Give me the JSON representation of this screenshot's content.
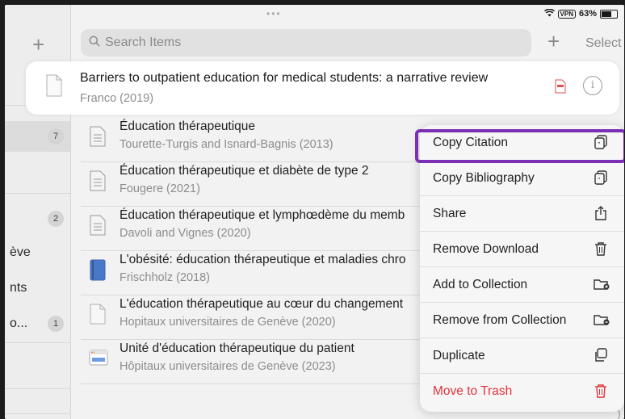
{
  "status_bar": {
    "dots": "•••",
    "vpn": "VPN",
    "battery": "63%"
  },
  "sidebar": {
    "items": [
      {
        "label": "",
        "count": "7"
      },
      {
        "label": "",
        "count": "2"
      },
      {
        "label": "ève",
        "count": ""
      },
      {
        "label": "nts",
        "count": ""
      },
      {
        "label": "o...",
        "count": "1"
      }
    ]
  },
  "toolbar": {
    "search_placeholder": "Search Items",
    "select_label": "Select"
  },
  "selected_item": {
    "title": "Barriers to outpatient education for medical students: a narrative review",
    "subtitle": "Franco (2019)"
  },
  "items": [
    {
      "title": "Éducation thérapeutique",
      "subtitle": "Tourette-Turgis and Isnard-Bagnis (2013)",
      "icon": "document-icon"
    },
    {
      "title": "Éducation thérapeutique et diabète de type 2",
      "subtitle": "Fougere (2021)",
      "icon": "document-icon"
    },
    {
      "title": "Éducation thérapeutique et lymphœdème du memb",
      "subtitle": "Davoli and Vignes (2020)",
      "icon": "document-icon"
    },
    {
      "title": "L'obésité: éducation thérapeutique et maladies chro",
      "subtitle": "Frischholz (2018)",
      "icon": "book-icon"
    },
    {
      "title": "L'éducation thérapeutique au cœur du changement",
      "subtitle": "Hopitaux universitaires de Genève  (2020)",
      "icon": "blank-document-icon"
    },
    {
      "title": "Unité d'éducation thérapeutique du patient",
      "subtitle": "Hôpitaux universitaires de Genève (2023)",
      "icon": "webpage-icon"
    }
  ],
  "context_menu": {
    "items": [
      {
        "label": "Copy Citation",
        "icon": "copy-citation-icon"
      },
      {
        "label": "Copy Bibliography",
        "icon": "copy-bibliography-icon"
      },
      {
        "label": "Share",
        "icon": "share-icon"
      },
      {
        "label": "Remove Download",
        "icon": "trash-icon"
      },
      {
        "label": "Add to Collection",
        "icon": "folder-add-icon"
      },
      {
        "label": "Remove from Collection",
        "icon": "folder-remove-icon"
      },
      {
        "label": "Duplicate",
        "icon": "duplicate-icon"
      },
      {
        "label": "Move to Trash",
        "icon": "trash-icon"
      }
    ]
  },
  "colors": {
    "highlight": "#7a2fb5",
    "danger": "#e2333a",
    "pdf": "#d9534f"
  }
}
